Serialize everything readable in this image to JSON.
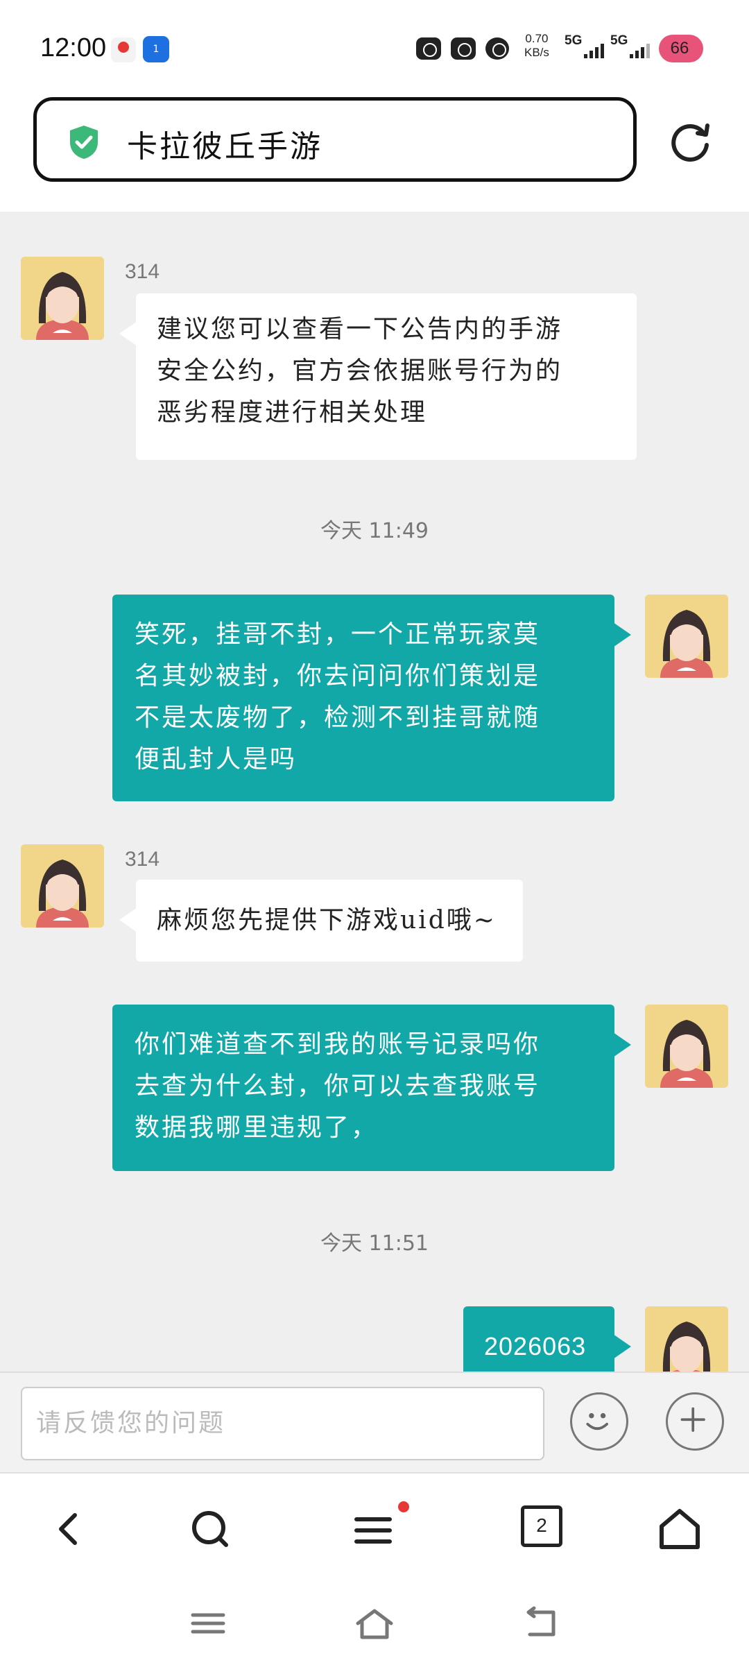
{
  "status_bar": {
    "time": "12:00",
    "app2_label": "1",
    "net_speed_value": "0.70",
    "net_speed_unit": "KB/s",
    "sim1": "5G",
    "sim2": "5G",
    "battery": "66",
    "icons": [
      "alarm-icon",
      "speedometer-icon",
      "app-icon"
    ]
  },
  "browser": {
    "url_title": "卡拉彼丘手游",
    "tab_count": "2",
    "menu_has_notification": true
  },
  "chat": {
    "messages": [
      {
        "side": "in",
        "sender": "314",
        "text_lines": [
          "建议您可以查看一下公告内的手游",
          "安全公约，官方会依据账号行为的",
          "恶劣程度进行相关处理"
        ]
      },
      {
        "side": "time",
        "text": "今天 11:49"
      },
      {
        "side": "out",
        "text_lines": [
          "笑死，挂哥不封，一个正常玩家莫",
          "名其妙被封，你去问问你们策划是",
          "不是太废物了，检测不到挂哥就随",
          "便乱封人是吗"
        ]
      },
      {
        "side": "in",
        "sender": "314",
        "text_lines": [
          "麻烦您先提供下游戏uid哦~"
        ]
      },
      {
        "side": "out",
        "text_lines": [
          "你们难道查不到我的账号记录吗你",
          "去查为什么封，你可以去查我账号",
          "数据我哪里违规了，"
        ]
      },
      {
        "side": "time",
        "text": "今天 11:51"
      },
      {
        "side": "out",
        "text_lines": [
          "2026063"
        ]
      }
    ]
  },
  "input": {
    "placeholder": "请反馈您的问题"
  },
  "colors": {
    "accent": "#13a8a8",
    "chat_bg": "#efefef",
    "shield": "#3cb878",
    "battery": "#e8537a"
  }
}
